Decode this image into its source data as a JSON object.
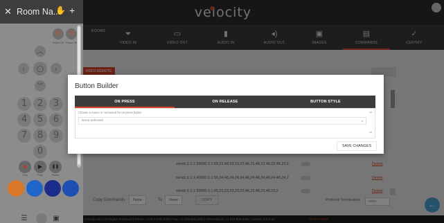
{
  "app": {
    "logo": "velocity",
    "tabs": [
      {
        "label": "ROOMS",
        "icon": "rooms-icon",
        "glyph": ""
      },
      {
        "label": "VIDEO IN",
        "icon": "video-in-icon",
        "glyph": "⏷"
      },
      {
        "label": "VIDEO OUT",
        "icon": "video-out-icon",
        "glyph": "▭"
      },
      {
        "label": "AUDIO IN",
        "icon": "audio-in-icon",
        "glyph": "▮"
      },
      {
        "label": "AUDIO OUT",
        "icon": "audio-out-icon",
        "glyph": "◂)"
      },
      {
        "label": "IMAGES",
        "icon": "images-icon",
        "glyph": "▣"
      },
      {
        "label": "COMMANDS",
        "icon": "commands-icon",
        "glyph": "▤"
      },
      {
        "label": "CERTIFY",
        "icon": "certify-icon",
        "glyph": "✓"
      }
    ],
    "active_tab": "COMMANDS",
    "section_tab": "VIDEO REMOTE",
    "commands": [
      {
        "text": "sendc:1:1:1:39000:1:1:59,23,48,23,23,23,48,23,48,23,48,23,48,23,2",
        "delete": "Delete"
      },
      {
        "text": "sendc:1:1:1:40000:1:1:56,24,48,24,24,24,48,24,48,24,48,24,48,24,2",
        "delete": "Delete"
      },
      {
        "text": "sendc:1:1:1:39000:1:1:95,23,23,23,23,23,48,23,48,23,48,23,2",
        "delete": "Delete"
      }
    ],
    "copy_commands_label": "Copy Commands",
    "copy_from_value": "None",
    "to_label": "To",
    "copy_to_value": "None",
    "copy_button": "COPY",
    "protocol_label": "Protocol Termination",
    "protocol_value": "none",
    "footer_text": "velocity.com | All Rights Reserved | Phone: +1 877.349.3100 | Fax: +1 610.555.0100 | International: +1 610.555.0199 | Version 2.6.5.12",
    "footer_terms": "AV Pro Terms"
  },
  "remote": {
    "title": "Room Na...",
    "power_on_label": "Power On",
    "power_off_label": "Power Off",
    "digits": [
      "1",
      "2",
      "3",
      "4",
      "5",
      "6",
      "7",
      "8",
      "9",
      "0"
    ],
    "media": [
      {
        "label": "Stop",
        "icon": "stop-icon",
        "glyph": "■",
        "color": "#c0392b"
      },
      {
        "label": "Play",
        "icon": "play-icon",
        "glyph": "▶",
        "color": "#1f1f1f"
      },
      {
        "label": "Pause",
        "icon": "pause-icon",
        "glyph": "❚❚",
        "color": "#1f1f1f"
      }
    ],
    "color_buttons": [
      "#d9782a",
      "#1e66c8",
      "#1a2d8a",
      "#1d4fb0"
    ]
  },
  "modal": {
    "title": "Button Builder",
    "tabs": [
      "ON PRESS",
      "ON RELEASE",
      "BUTTON STYLE"
    ],
    "active_tab": "ON PRESS",
    "help_text": "Choose a macro or command for on-press button",
    "select_value": "None selected",
    "save_button": "SAVE CHANGES"
  }
}
